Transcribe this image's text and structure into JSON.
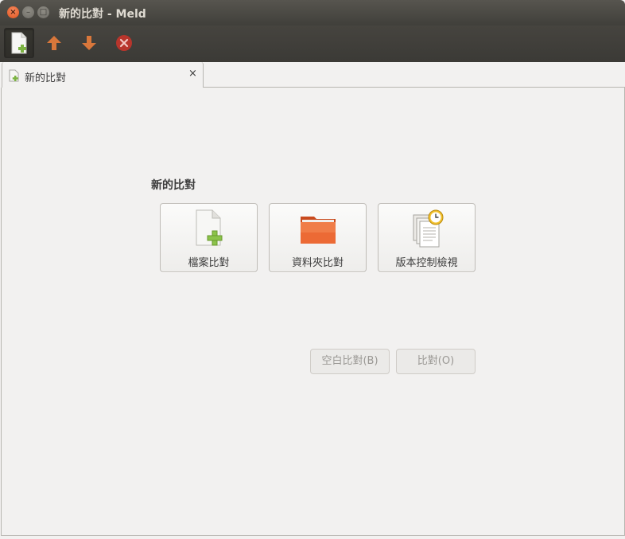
{
  "window": {
    "title": "新的比對 - Meld"
  },
  "toolbar": {
    "buttons": [
      {
        "icon": "new-comparison-icon",
        "active": true
      },
      {
        "icon": "arrow-up-icon"
      },
      {
        "icon": "arrow-down-icon"
      },
      {
        "icon": "stop-icon"
      }
    ]
  },
  "tab": {
    "label": "新的比對",
    "close": "×"
  },
  "main": {
    "heading": "新的比對",
    "options": [
      {
        "label": "檔案比對",
        "icon": "file-add-icon"
      },
      {
        "label": "資料夾比對",
        "icon": "folder-icon"
      },
      {
        "label": "版本控制檢視",
        "icon": "version-control-icon"
      }
    ],
    "blank_button": "空白比對(B)",
    "compare_button": "比對(O)"
  },
  "colors": {
    "accent_orange": "#e95420",
    "titlebar": "#4c4b46",
    "green": "#8bc34a"
  }
}
